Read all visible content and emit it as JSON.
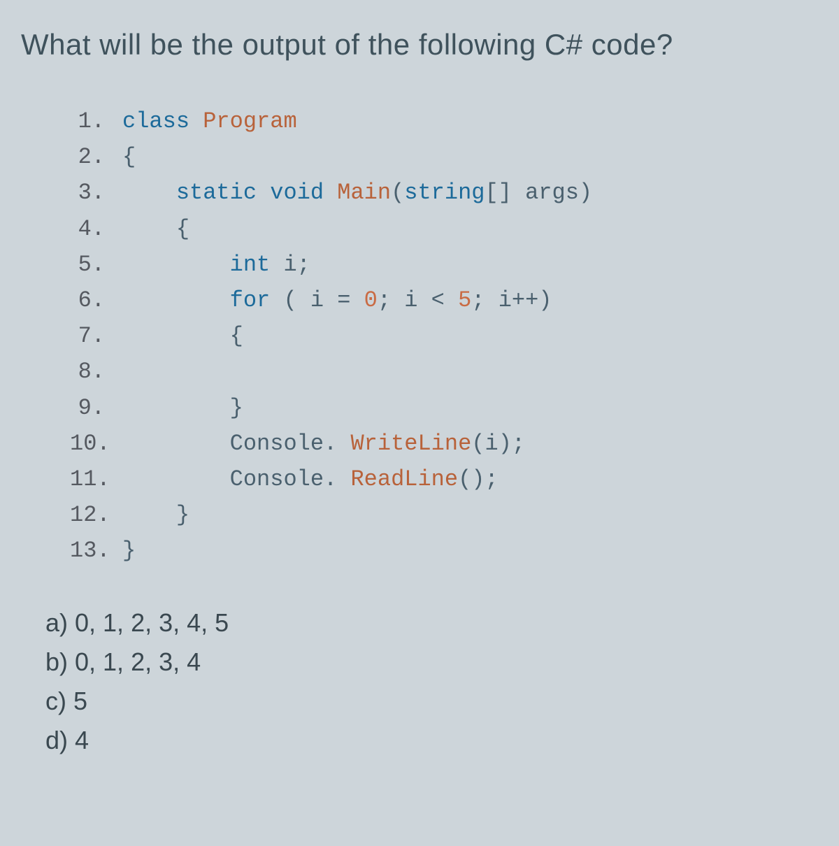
{
  "question": "What will be the output of the following C# code?",
  "code": {
    "lines": [
      {
        "num": "1.",
        "tokens": [
          [
            "kw-class",
            "class"
          ],
          [
            "",
            ""
          ],
          [
            "id-program",
            " Program"
          ]
        ]
      },
      {
        "num": "2.",
        "tokens": [
          [
            "brace",
            "{"
          ]
        ]
      },
      {
        "num": "3.",
        "tokens": [
          [
            "",
            "    "
          ],
          [
            "kw-static",
            "static"
          ],
          [
            "",
            " "
          ],
          [
            "kw-void",
            "void"
          ],
          [
            "",
            " "
          ],
          [
            "id-main",
            "Main"
          ],
          [
            "punct",
            "("
          ],
          [
            "kw-type",
            "string"
          ],
          [
            "punct",
            "[] "
          ],
          [
            "id-args",
            "args"
          ],
          [
            "punct",
            ")"
          ]
        ]
      },
      {
        "num": "4.",
        "tokens": [
          [
            "",
            "    "
          ],
          [
            "brace",
            "{"
          ]
        ]
      },
      {
        "num": "5.",
        "tokens": [
          [
            "",
            "        "
          ],
          [
            "kw-int",
            "int"
          ],
          [
            "",
            " "
          ],
          [
            "id-var",
            "i"
          ],
          [
            "punct",
            ";"
          ]
        ]
      },
      {
        "num": "6.",
        "tokens": [
          [
            "",
            "        "
          ],
          [
            "kw-for",
            "for"
          ],
          [
            "punct",
            " ( "
          ],
          [
            "id-var",
            "i"
          ],
          [
            "punct",
            " = "
          ],
          [
            "num",
            "0"
          ],
          [
            "punct",
            "; "
          ],
          [
            "id-var",
            "i"
          ],
          [
            "punct",
            " < "
          ],
          [
            "num",
            "5"
          ],
          [
            "punct",
            "; "
          ],
          [
            "id-var",
            "i++"
          ],
          [
            "punct",
            ")"
          ]
        ]
      },
      {
        "num": "7.",
        "tokens": [
          [
            "",
            "        "
          ],
          [
            "brace",
            "{"
          ]
        ]
      },
      {
        "num": "8.",
        "tokens": [
          [
            "",
            ""
          ]
        ]
      },
      {
        "num": "9.",
        "tokens": [
          [
            "",
            "        "
          ],
          [
            "brace",
            "}"
          ]
        ]
      },
      {
        "num": "10.",
        "tokens": [
          [
            "",
            "        "
          ],
          [
            "id-console",
            "Console"
          ],
          [
            "punct",
            ". "
          ],
          [
            "id-write",
            "WriteLine"
          ],
          [
            "punct",
            "("
          ],
          [
            "id-var",
            "i"
          ],
          [
            "punct",
            ");"
          ]
        ]
      },
      {
        "num": "11.",
        "tokens": [
          [
            "",
            "        "
          ],
          [
            "id-console",
            "Console"
          ],
          [
            "punct",
            ". "
          ],
          [
            "id-read",
            "ReadLine"
          ],
          [
            "punct",
            "();"
          ]
        ]
      },
      {
        "num": "12.",
        "tokens": [
          [
            "",
            "    "
          ],
          [
            "brace",
            "}"
          ]
        ]
      },
      {
        "num": "13.",
        "tokens": [
          [
            "brace",
            "}"
          ]
        ]
      }
    ]
  },
  "answers": [
    "a) 0, 1, 2, 3, 4, 5",
    "b) 0, 1, 2, 3, 4",
    "c) 5",
    "d) 4"
  ]
}
